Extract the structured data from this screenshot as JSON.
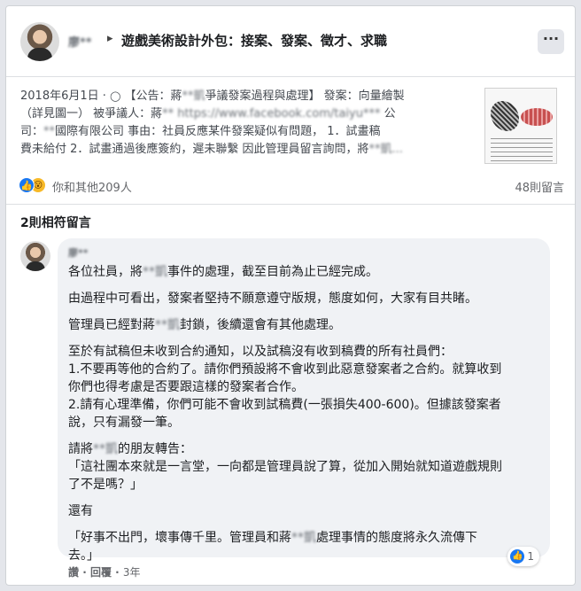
{
  "header": {
    "author_name": "廖**",
    "arrow": "▸",
    "group_name": "遊戲美術設計外包：接案、發案、徵才、求職",
    "more_label": "···"
  },
  "post": {
    "date": "2018年6月1日",
    "dot": "·",
    "line1_rest": "【公告：蔣",
    "line1_blur": "**凱",
    "line1_after": "爭議發案過程與處理】 發案：向量繪製",
    "line2_start": "（詳見圖一） 被爭議人：蔣",
    "line2_blur": "** https://www.facebook.com/taiyu***",
    "line2_end": " 公",
    "line3_start": "司：",
    "line3_blur": "**",
    "line3_rest": "國際有限公司 事由：社員反應某件發案疑似有問題， 1．試畫稿",
    "line4": "費未給付 2．試畫通過後應簽約，遲未聯繫 因此管理員留言詢問，將",
    "line4_blur": "**凱..."
  },
  "reactions": {
    "like_icon": "👍",
    "wow_icon": "😮",
    "text": "你和其他209人",
    "comments": "48則留言"
  },
  "matching": {
    "heading": "2則相符留言"
  },
  "comment": {
    "author": "廖**",
    "p1_a": "各位社員，將",
    "p1_blur": "**凱",
    "p1_b": "事件的處理，截至目前為止已經完成。",
    "p2": "由過程中可看出，發案者堅持不願意遵守版規，態度如何，大家有目共睹。",
    "p3_a": "管理員已經對蔣",
    "p3_blur": "**凱",
    "p3_b": "封鎖，後續還會有其他處理。",
    "p4_l1": "至於有試稿但未收到合約通知，以及試稿沒有收到稿費的所有社員們：",
    "p4_l2": "1.不要再等他的合約了。請你們預設將不會收到此惡意發案者之合約。就算收到",
    "p4_l3": "你們也得考慮是否要跟這樣的發案者合作。",
    "p4_l4": "2.請有心理準備，你們可能不會收到試稿費(一張損失400-600)。但據該發案者",
    "p4_l5": "說，只有漏發一筆。",
    "p5_a": "請將",
    "p5_blur": "**凱",
    "p5_b": "的朋友轉告：",
    "p5_q1": "「這社團本來就是一言堂，一向都是管理員說了算，從加入開始就知道遊戲規則",
    "p5_q2": "了不是嗎？」",
    "p6": "還有",
    "p7_l1_a": "「好事不出門，壞事傳千里。管理員和蔣",
    "p7_l1_blur": "**凱",
    "p7_l1_b": "處理事情的態度將永久流傳下",
    "p7_l2": "去。」",
    "react_icon": "👍",
    "react_count": "1",
    "actions_like": "讚",
    "actions_sep1": " · ",
    "actions_reply": "回覆",
    "actions_sep2": " · ",
    "actions_time": "3年"
  },
  "colors": {
    "accent": "#1877f2",
    "bubble": "#f0f2f5",
    "secondary_text": "#65676b"
  }
}
